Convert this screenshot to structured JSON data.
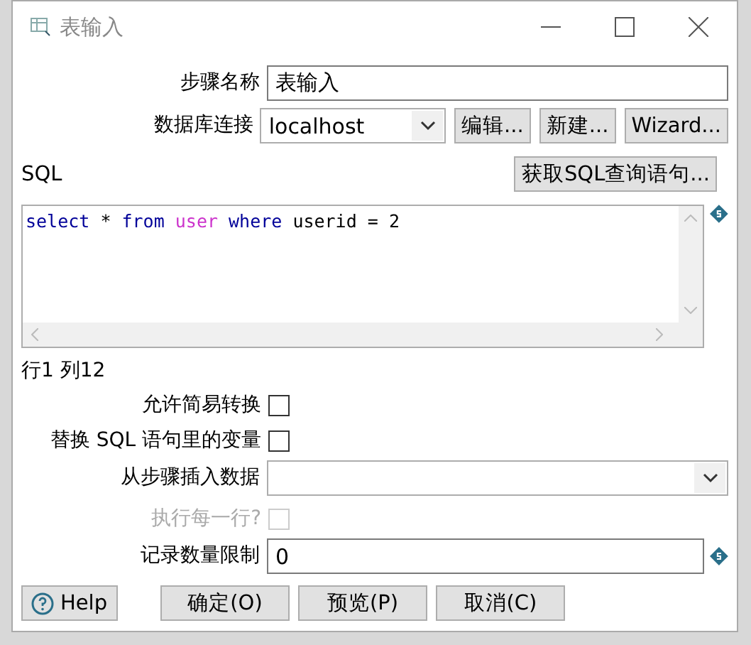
{
  "window": {
    "title": "表输入"
  },
  "step_name": {
    "label": "步骤名称",
    "value": "表输入"
  },
  "connection": {
    "label": "数据库连接",
    "value": "localhost",
    "buttons": [
      "编辑...",
      "新建...",
      "Wizard..."
    ]
  },
  "sql": {
    "label": "SQL",
    "get_button": "获取SQL查询语句...",
    "tokens": [
      {
        "text": "select",
        "kind": "keyword"
      },
      {
        "text": "*",
        "kind": "plain"
      },
      {
        "text": "from",
        "kind": "keyword"
      },
      {
        "text": "user",
        "kind": "table"
      },
      {
        "text": "where",
        "kind": "keyword"
      },
      {
        "text": "userid",
        "kind": "plain"
      },
      {
        "text": "=",
        "kind": "plain"
      },
      {
        "text": "2",
        "kind": "plain"
      }
    ]
  },
  "cursor_position": "行1 列12",
  "options": [
    {
      "label": "允许简易转换",
      "checked": false,
      "disabled": false
    },
    {
      "label": "替换 SQL 语句里的变量",
      "checked": false,
      "disabled": false
    }
  ],
  "insert_from_step": {
    "label": "从步骤插入数据"
  },
  "execute_each_row": {
    "label": "执行每一行?",
    "checked": false,
    "disabled": true
  },
  "limit": {
    "label": "记录数量限制",
    "value": "0"
  },
  "help_button": "Help",
  "buttons": [
    "确定(O)",
    "预览(P)",
    "取消(C)"
  ]
}
